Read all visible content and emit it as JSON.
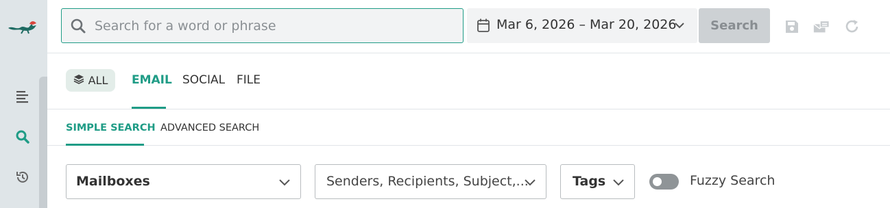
{
  "sidebar": {
    "logo_icon": "fox-logo-icon",
    "items": [
      {
        "icon": "menu-lines-icon",
        "active": false
      },
      {
        "icon": "search-icon",
        "active": true
      },
      {
        "icon": "history-icon",
        "active": false
      }
    ]
  },
  "topbar": {
    "search_placeholder": "Search for a word or phrase",
    "date_range": "Mar 6, 2026 – Mar 20, 2026",
    "search_button": "Search",
    "toolbar_icons": [
      "save-icon",
      "mail-stack-icon",
      "redo-icon"
    ]
  },
  "tabs": {
    "all": "ALL",
    "email": "EMAIL",
    "social": "SOCIAL",
    "file": "FILE",
    "active": "EMAIL"
  },
  "subtabs": {
    "simple": "SIMPLE SEARCH",
    "advanced": "ADVANCED SEARCH",
    "active": "SIMPLE SEARCH"
  },
  "filters": {
    "mailboxes": "Mailboxes",
    "fields": "Senders, Recipients, Subject,...",
    "tags": "Tags",
    "fuzzy_label": "Fuzzy Search",
    "fuzzy_enabled": false
  },
  "colors": {
    "accent": "#1f9c86",
    "sidebar_bg": "#dfe5e8",
    "disabled": "#cdd1d4"
  }
}
